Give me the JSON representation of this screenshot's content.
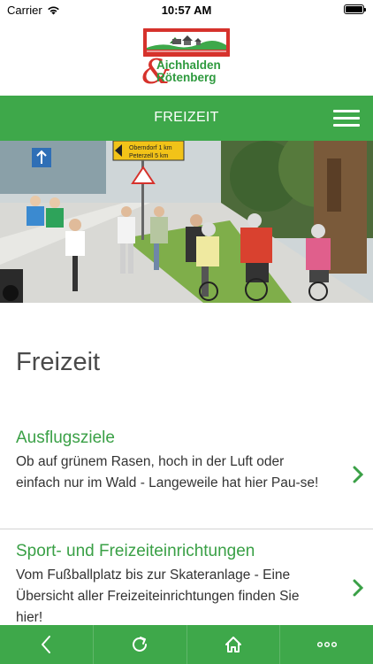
{
  "status_bar": {
    "carrier": "Carrier",
    "time": "10:57 AM"
  },
  "logo": {
    "line1": "Aichhalden",
    "line2": "Rötenberg",
    "ampersand": "&"
  },
  "nav": {
    "title": "FREIZEIT"
  },
  "hero": {
    "sign_line1": "Oberndorf 1 km",
    "sign_line2": "Peterzell 5 km"
  },
  "page": {
    "title": "Freizeit"
  },
  "items": [
    {
      "title": "Ausflugsziele",
      "description": "Ob auf grünem Rasen, hoch in der Luft oder einfach nur im Wald - Langeweile hat hier Pau-se!"
    },
    {
      "title": "Sport- und Freizeiteinrichtungen",
      "description": "Vom Fußballplatz bis zur Skateranlage - Eine Übersicht aller Freizeiteinrichtungen finden Sie hier!"
    }
  ],
  "colors": {
    "brand_green": "#3ea84a",
    "brand_red": "#d6322c",
    "link_green": "#3aa046"
  },
  "toolbar": {
    "icons": [
      "back-icon",
      "reload-icon",
      "home-icon",
      "more-icon"
    ]
  }
}
